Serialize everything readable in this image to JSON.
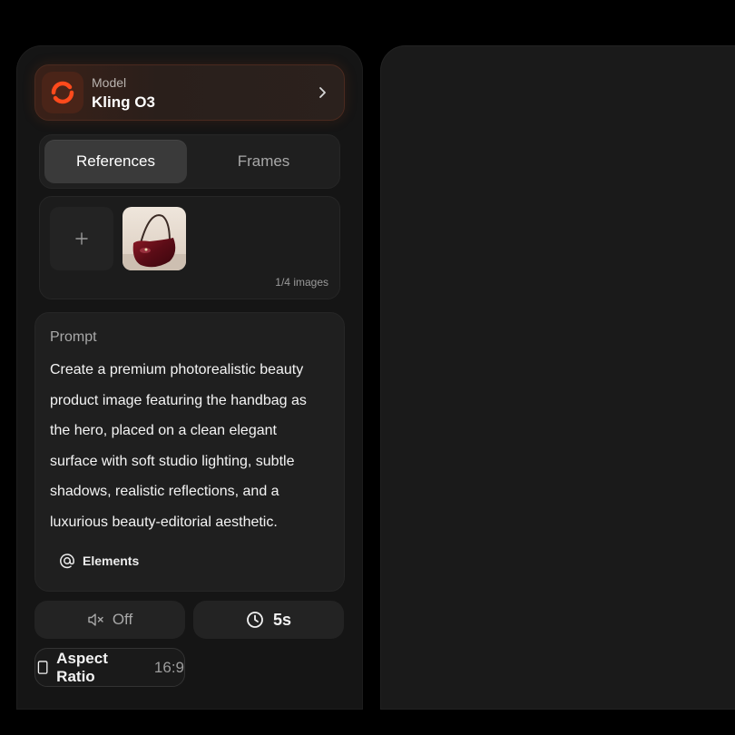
{
  "model": {
    "label": "Model",
    "name": "Kling O3",
    "accent": "#e8421b"
  },
  "tabs": [
    {
      "label": "References",
      "active": true
    },
    {
      "label": "Frames",
      "active": false
    }
  ],
  "references": {
    "count_label": "1/4 images",
    "thumbnail": "handbag-image"
  },
  "prompt": {
    "label": "Prompt",
    "lines": [
      "Create a premium photorealistic beauty",
      "product image featuring the handbag as",
      "the hero, placed on a clean elegant",
      "surface with soft studio lighting, subtle",
      "shadows, realistic reflections, and a",
      "luxurious beauty-editorial aesthetic."
    ],
    "elements_label": "Elements"
  },
  "controls": {
    "sound_label": "Off",
    "duration_label": "5s",
    "aspect_label": "Aspect Ratio",
    "aspect_value": "16:9"
  }
}
